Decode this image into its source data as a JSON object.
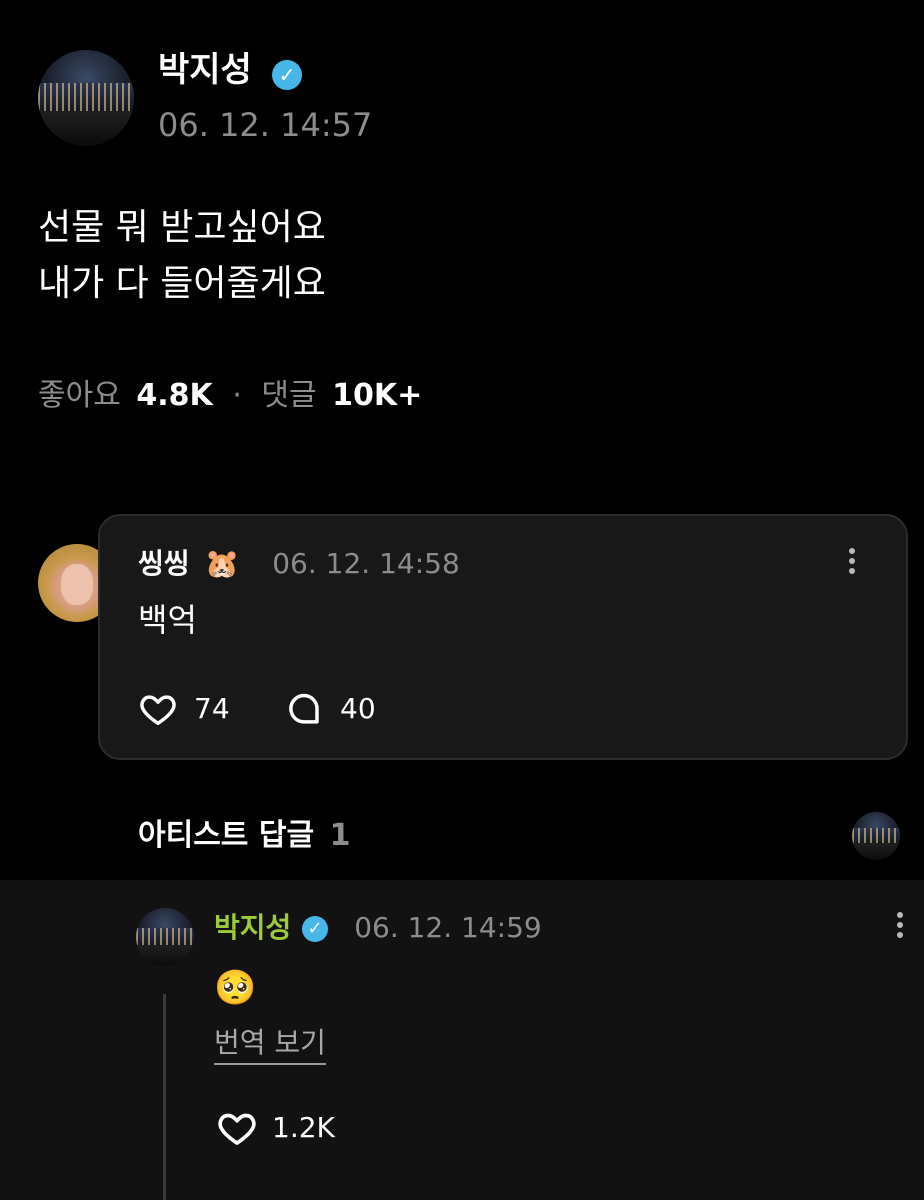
{
  "post": {
    "author": "박지성",
    "timestamp": "06. 12. 14:57",
    "lines": [
      "선물 뭐 받고싶어요",
      "내가 다 들어줄게요"
    ],
    "likes_label": "좋아요",
    "likes_count": "4.8K",
    "separator": "·",
    "comments_label": "댓글",
    "comments_count": "10K+"
  },
  "comment": {
    "author": "씽씽",
    "author_emoji": "🐹",
    "timestamp": "06. 12. 14:58",
    "text": "백억",
    "likes": "74",
    "replies": "40"
  },
  "artist_replies": {
    "label": "아티스트 답글",
    "count": "1"
  },
  "reply": {
    "author": "박지성",
    "timestamp": "06. 12. 14:59",
    "text": "🥺",
    "translate_label": "번역 보기",
    "likes": "1.2K"
  },
  "colors": {
    "background": "#000000",
    "card": "#181818",
    "reply_panel": "#121212",
    "verified": "#46b7e8",
    "artist_name": "#9ccb3c",
    "muted": "#8c8c8c"
  },
  "icons": [
    "verified-badge-icon",
    "kebab-menu-icon",
    "heart-icon",
    "comment-bubble-icon"
  ]
}
